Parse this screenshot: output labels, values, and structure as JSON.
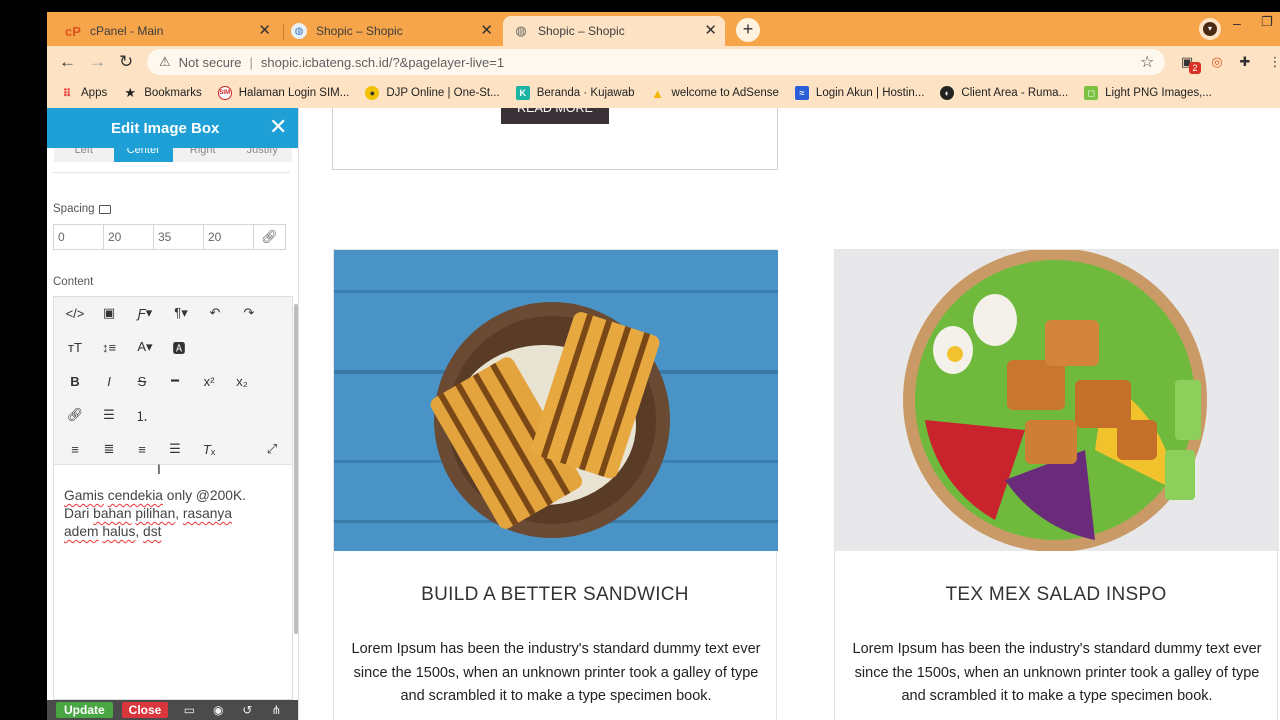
{
  "browser": {
    "tabs": [
      {
        "title": "cPanel - Main",
        "active": false
      },
      {
        "title": "Shopic – Shopic",
        "active": false
      },
      {
        "title": "Shopic – Shopic",
        "active": true
      }
    ],
    "address": {
      "security": "Not secure",
      "url": "shopic.icbateng.sch.id/?&pagelayer-live=1"
    },
    "extension_badge": "2",
    "bookmarks": [
      {
        "label": "Apps"
      },
      {
        "label": "Bookmarks"
      },
      {
        "label": "Halaman Login SIM..."
      },
      {
        "label": "DJP Online | One-St..."
      },
      {
        "label": "Beranda · Kujawab"
      },
      {
        "label": "welcome to AdSense"
      },
      {
        "label": "Login Akun | Hostin..."
      },
      {
        "label": "Client Area - Ruma..."
      },
      {
        "label": "Light PNG Images,..."
      }
    ]
  },
  "editor": {
    "title": "Edit Image Box",
    "align_options": [
      "Left",
      "Center",
      "Right",
      "Justify"
    ],
    "align_selected": "Center",
    "spacing_label": "Spacing",
    "spacing_values": [
      "0",
      "20",
      "35",
      "20"
    ],
    "content_label": "Content",
    "content_lines": [
      {
        "parts": [
          {
            "t": "Gamis",
            "sq": true
          },
          {
            "t": " ",
            "sq": false
          },
          {
            "t": "cendekia",
            "sq": true
          },
          {
            "t": " only @200K.",
            "sq": false
          }
        ]
      },
      {
        "parts": [
          {
            "t": "Dari",
            "sq": false
          },
          {
            "t": " ",
            "sq": false
          },
          {
            "t": "bahan",
            "sq": true
          },
          {
            "t": " ",
            "sq": false
          },
          {
            "t": "pilihan",
            "sq": true
          },
          {
            "t": ", ",
            "sq": false
          },
          {
            "t": "rasanya",
            "sq": true
          }
        ]
      },
      {
        "parts": [
          {
            "t": "adem",
            "sq": true
          },
          {
            "t": " ",
            "sq": false
          },
          {
            "t": "halus",
            "sq": true
          },
          {
            "t": ", ",
            "sq": false
          },
          {
            "t": "dst",
            "sq": true
          }
        ]
      }
    ],
    "update_label": "Update",
    "close_label": "Close"
  },
  "page": {
    "read_more": "READ MORE",
    "cards": [
      {
        "title": "BUILD A BETTER SANDWICH",
        "text": "Lorem Ipsum has been the industry's standard dummy text ever since the 1500s, when an unknown printer took a galley of type and scrambled it to make a type specimen book."
      },
      {
        "title": "TEX MEX SALAD INSPO",
        "text": "Lorem Ipsum has been the industry's standard dummy text ever since the 1500s, when an unknown printer took a galley of type and scrambled it to make a type specimen book."
      }
    ]
  },
  "colors": {
    "tabstrip": "#f6a54a",
    "toolbar": "#fde3c4",
    "editor_header": "#1ea0d6",
    "update_button": "#49a642",
    "close_button": "#d9363e",
    "read_more_bg": "#3b3237"
  }
}
